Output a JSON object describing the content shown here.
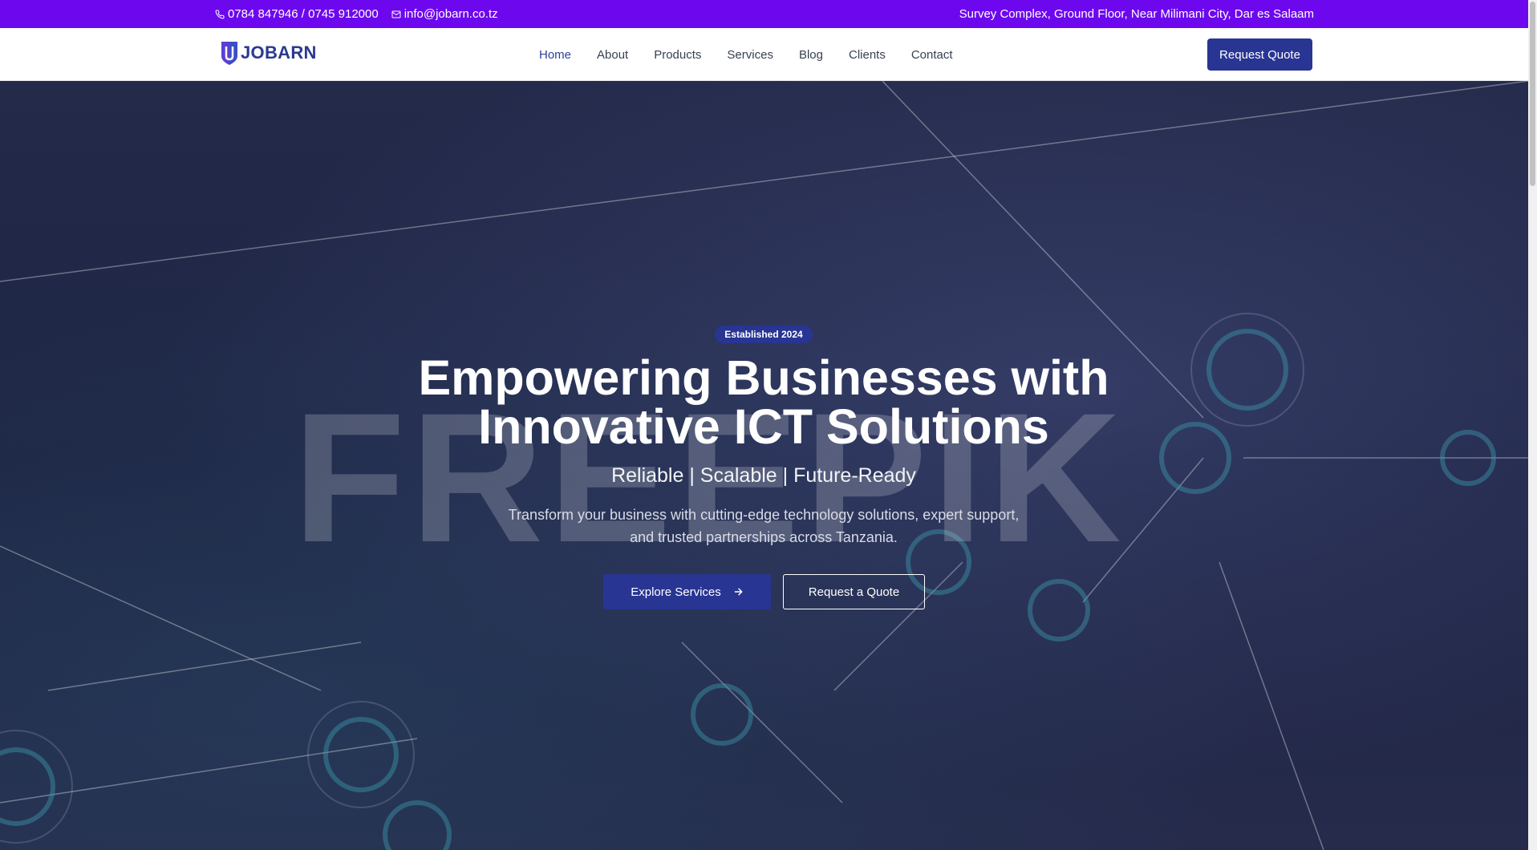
{
  "topbar": {
    "phone": "0784 847946 / 0745 912000",
    "email": "info@jobarn.co.tz",
    "address": "Survey Complex, Ground Floor, Near Milimani City, Dar es Salaam"
  },
  "nav": {
    "logo_text": "JOBARN",
    "links": [
      "Home",
      "About",
      "Products",
      "Services",
      "Blog",
      "Clients",
      "Contact"
    ],
    "active": "Home",
    "cta_label": "Request Quote"
  },
  "hero": {
    "badge": "Established 2024",
    "title_line1": "Empowering Businesses with",
    "title_line2": "Innovative ICT Solutions",
    "subtitle": "Reliable | Scalable | Future-Ready",
    "description": "Transform your business with cutting-edge technology solutions, expert support, and trusted partnerships across Tanzania.",
    "primary_button": "Explore Services",
    "secondary_button": "Request a Quote",
    "watermark": "FREEPIK"
  },
  "colors": {
    "topbar": "#6d08ee",
    "brand": "#283593",
    "hero_overlay": "#1d2342"
  },
  "icons": {
    "phone": "phone-icon",
    "email": "mail-icon",
    "arrow": "arrow-right-icon",
    "logo": "shield-logo-icon"
  }
}
